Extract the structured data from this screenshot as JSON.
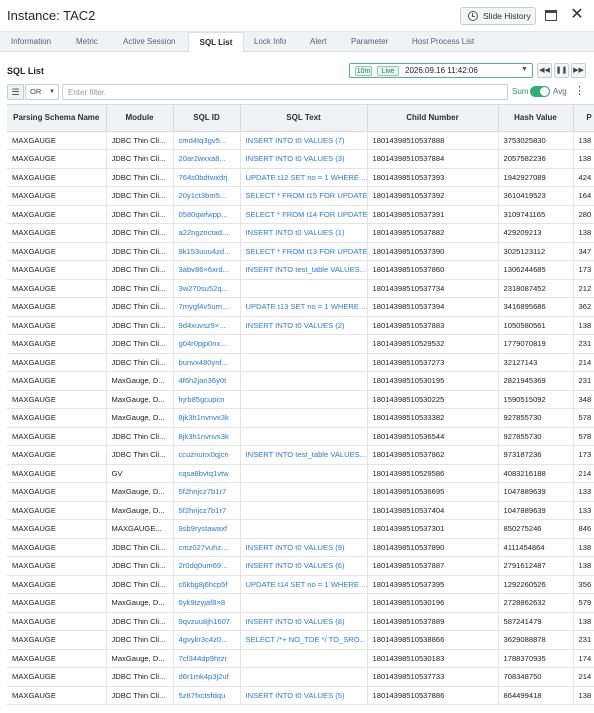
{
  "window": {
    "title": "Instance: TAC2",
    "slide_history_label": "Slide History"
  },
  "tabs": [
    "Information",
    "Metric",
    "Active Session",
    "SQL List",
    "Lock Info",
    "Alert",
    "Parameter",
    "Host Process List"
  ],
  "active_tab": "SQL List",
  "section_title": "SQL List",
  "time_range": {
    "range": "10m",
    "mode": "Live",
    "datetime": "2026.09.16 11:42:06"
  },
  "filter": {
    "logic": "OR",
    "placeholder": "Enter filter.",
    "value": "",
    "sum_label": "Sum",
    "avg_label": "Avg",
    "sum_avg_toggle": "Sum"
  },
  "table": {
    "columns": [
      "Parsing Schema Name",
      "Module",
      "SQL ID",
      "SQL Text",
      "Child Number",
      "Hash Value",
      "P"
    ],
    "rows": [
      [
        "MAXGAUGE",
        "JDBC Thin Cli...",
        "cmd4tq3gv5...",
        "INSERT INTO t0 VALUES (7)",
        "18014398510537888",
        "3753025830",
        "138"
      ],
      [
        "MAXGAUGE",
        "JDBC Thin Cli...",
        "20ar2wxxa8...",
        "INSERT INTO t0 VALUES (3)",
        "18014398510537884",
        "2057582236",
        "138"
      ],
      [
        "MAXGAUGE",
        "JDBC Thin Cli...",
        "764s0bdtwxdrj",
        "UPDATE t12 SET no = 1 WHERE ...",
        "18014398510537393",
        "1942927089",
        "424"
      ],
      [
        "MAXGAUGE",
        "JDBC Thin Cli...",
        "20y1ct3bm5...",
        "SELECT * FROM t15 FOR UPDATE",
        "18014398510537392",
        "3610419523",
        "164"
      ],
      [
        "MAXGAUGE",
        "JDBC Thin Cli...",
        "0580qwfwpp...",
        "SELECT * FROM t14 FOR UPDATE",
        "18014398510537391",
        "3109741165",
        "280"
      ],
      [
        "MAXGAUGE",
        "JDBC Thin Cli...",
        "a22ngznctad...",
        "INSERT INTO t0 VALUES (1)",
        "18014398510537882",
        "429209213",
        "138"
      ],
      [
        "MAXGAUGE",
        "JDBC Thin Cli...",
        "9k153uuu4zd...",
        "SELECT * FROM t13 FOR UPDATE",
        "18014398510537390",
        "3025123112",
        "347"
      ],
      [
        "MAXGAUGE",
        "JDBC Thin Cli...",
        "3abv86×6xrd...",
        "INSERT INTO test_table VALUES...",
        "18014398510537860",
        "1306244685",
        "173"
      ],
      [
        "MAXGAUGE",
        "JDBC Thin Cli...",
        "3w270su52q...",
        "",
        "18014398510537734",
        "2318087452",
        "212"
      ],
      [
        "MAXGAUGE",
        "JDBC Thin Cli...",
        "7mygf4v5um...",
        "UPDATE t13 SET no = 1 WHERE ...",
        "18014398510537394",
        "3416895686",
        "362"
      ],
      [
        "MAXGAUGE",
        "JDBC Thin Cli...",
        "9d4xuvsz9×...",
        "INSERT INTO t0 VALUES (2)",
        "18014398510537883",
        "1050580561",
        "138"
      ],
      [
        "MAXGAUGE",
        "JDBC Thin Cli...",
        "g04r0pjp0nx...",
        "",
        "18014398510529532",
        "1779070819",
        "231"
      ],
      [
        "MAXGAUGE",
        "JDBC Thin Cli...",
        "bunvx480ynf...",
        "",
        "18014398510537273",
        "32127143",
        "214"
      ],
      [
        "MAXGAUGE",
        "MaxGauge, D...",
        "4f6h2jan36y0t",
        "",
        "18014398510530195",
        "2821945369",
        "231"
      ],
      [
        "MAXGAUGE",
        "MaxGauge, D...",
        "frjrb85gcupcn",
        "",
        "18014398510530225",
        "1590515092",
        "348"
      ],
      [
        "MAXGAUGE",
        "MaxGauge, D...",
        "8jk3h1nvnvx3k",
        "",
        "18014398510533382",
        "927855730",
        "578"
      ],
      [
        "MAXGAUGE",
        "JDBC Thin Cli...",
        "8jk3h1nvnvx3k",
        "",
        "18014398510536544",
        "927855730",
        "578"
      ],
      [
        "MAXGAUGE",
        "JDBC Thin Cli...",
        "ccuznunx0qjcn",
        "INSERT INTO test_table VALUES...",
        "18014398510537862",
        "973187236",
        "173"
      ],
      [
        "MAXGAUGE",
        "GV",
        "cqsa8bvtq1vtw",
        "",
        "18014398510529586",
        "4083216188",
        "214"
      ],
      [
        "MAXGAUGE",
        "MaxGauge, D...",
        "5f2hnjcz7b1r7",
        "",
        "18014398510536695",
        "1047889639",
        "133"
      ],
      [
        "MAXGAUGE",
        "MaxGauge, D...",
        "5f2hnjcz7b1r7",
        "",
        "18014398510537404",
        "1047889639",
        "133"
      ],
      [
        "MAXGAUGE",
        "MAXGAUGE...",
        "9sb9rystawaxf",
        "",
        "18014398510537301",
        "850275246",
        "846"
      ],
      [
        "MAXGAUGE",
        "JDBC Thin Cli...",
        "cmz027vuhz...",
        "INSERT INTO t0 VALUES (9)",
        "18014398510537890",
        "4111454864",
        "138"
      ],
      [
        "MAXGAUGE",
        "JDBC Thin Cli...",
        "2r0dq0um69...",
        "INSERT INTO t0 VALUES (6)",
        "18014398510537887",
        "2791612487",
        "138"
      ],
      [
        "MAXGAUGE",
        "JDBC Thin Cli...",
        "c6kbg8j6hcp5f",
        "UPDATE t14 SET no = 1 WHERE ...",
        "18014398510537395",
        "1292260526",
        "356"
      ],
      [
        "MAXGAUGE",
        "MaxGauge, D...",
        "6yk9tzyjaf8×8",
        "",
        "18014398510530196",
        "2728862632",
        "579"
      ],
      [
        "MAXGAUGE",
        "JDBC Thin Cli...",
        "9qvzuu8jh1607",
        "INSERT INTO t0 VALUES (8)",
        "18014398510537889",
        "587241479",
        "138"
      ],
      [
        "MAXGAUGE",
        "JDBC Thin Cli...",
        "4gvykr3c4z0...",
        "SELECT /*+ NO_TDE */ TO_SRO...",
        "18014398510538866",
        "3629088878",
        "231"
      ],
      [
        "MAXGAUGE",
        "MaxGauge, D...",
        "7cf344dp9hrzr",
        "",
        "18014398510530183",
        "1788370935",
        "174"
      ],
      [
        "MAXGAUGE",
        "JDBC Thin Cli...",
        "d6r1mk4p3j2uf",
        "",
        "18014398510537733",
        "708348750",
        "214"
      ],
      [
        "MAXGAUGE",
        "JDBC Thin Cli...",
        "5z87fxctsfdqu",
        "INSERT INTO t0 VALUES (5)",
        "18014398510537886",
        "864499418",
        "138"
      ]
    ]
  }
}
